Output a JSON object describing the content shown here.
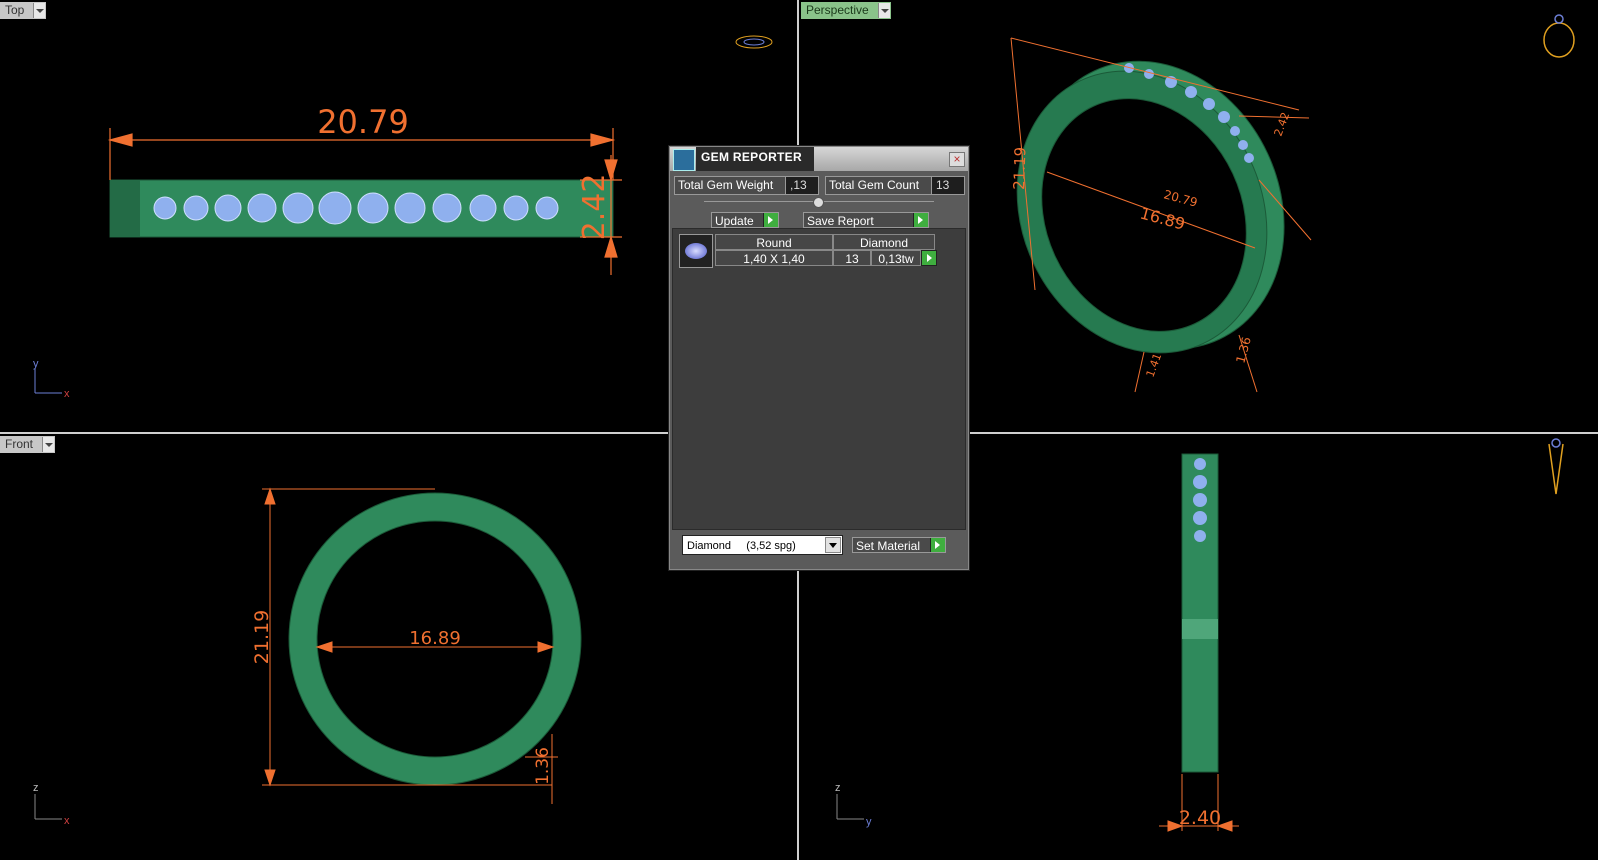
{
  "viewports": {
    "top": {
      "label": "Top",
      "dim_width": "20.79",
      "dim_height": "2.42",
      "axis_v": "y",
      "axis_h": "x"
    },
    "perspective": {
      "label": "Perspective",
      "dim_height": "21.19",
      "dim_inner": "16.89",
      "dim_top": "20.79",
      "dim_small_a": "2.42",
      "dim_small_b": "1.36",
      "dim_small_c": "1.41"
    },
    "front": {
      "label": "Front",
      "dim_height": "21.19",
      "dim_inner": "16.89",
      "dim_thickness": "1.36",
      "axis_v": "z",
      "axis_h": "x"
    },
    "right": {
      "dim_width": "2.40",
      "axis_v": "z",
      "axis_h": "y"
    }
  },
  "gem_reporter": {
    "title": "GEM REPORTER",
    "total_weight_label": "Total Gem Weight",
    "total_weight_value": ",13",
    "total_count_label": "Total Gem Count",
    "total_count_value": "13",
    "update_label": "Update",
    "save_report_label": "Save Report",
    "row": {
      "cut": "Round",
      "material": "Diamond",
      "size": "1,40 X 1,40",
      "count": "13",
      "weight": "0,13tw"
    },
    "material_select": "Diamond     (3,52 spg)",
    "set_material_label": "Set Material"
  },
  "colors": {
    "ring_green": "#2f8a5c",
    "dimension_orange": "#f07030",
    "gem_blue": "#8fb0ee"
  }
}
